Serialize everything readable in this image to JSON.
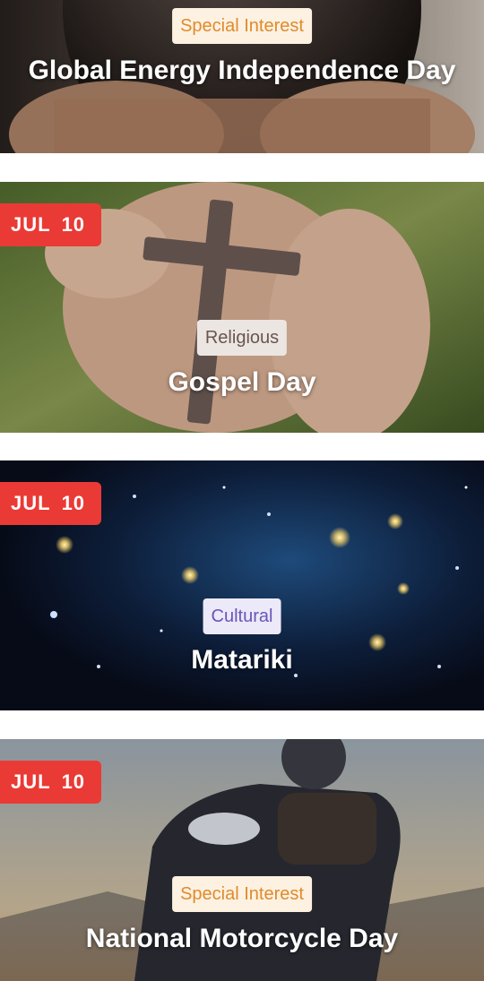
{
  "events": [
    {
      "category": "Special Interest",
      "title": "Global Energy Independence Day"
    },
    {
      "date_month": "JUL",
      "date_day": "10",
      "category": "Religious",
      "title": "Gospel Day"
    },
    {
      "date_month": "JUL",
      "date_day": "10",
      "category": "Cultural",
      "title": "Matariki"
    },
    {
      "date_month": "JUL",
      "date_day": "10",
      "category": "Special Interest",
      "title": "National Motorcycle Day"
    }
  ]
}
